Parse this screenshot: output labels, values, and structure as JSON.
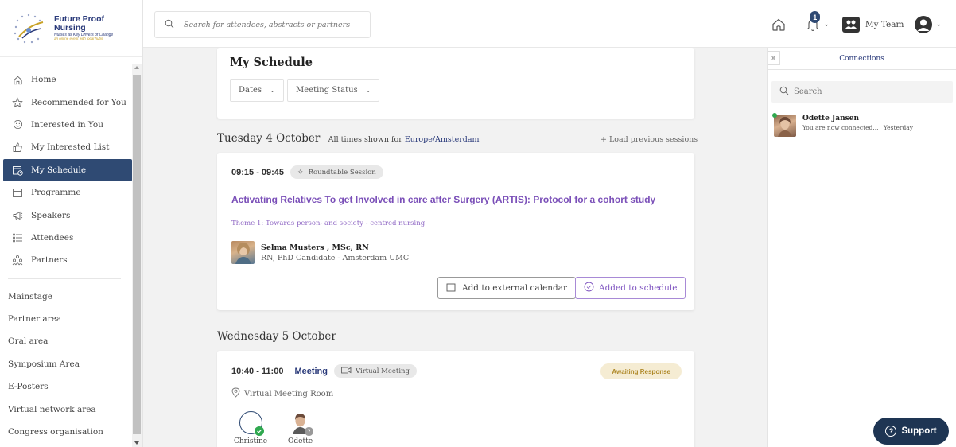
{
  "brand": {
    "title": "Future Proof Nursing",
    "subtitle": "Nurses as Key Drivers of Change",
    "tagline": "an online event with local hubs"
  },
  "sidebar": {
    "items": [
      {
        "label": "Home",
        "icon": "home-icon"
      },
      {
        "label": "Recommended for You",
        "icon": "star-icon"
      },
      {
        "label": "Interested in You",
        "icon": "smiley-icon"
      },
      {
        "label": "My Interested List",
        "icon": "thumbs-up-icon"
      },
      {
        "label": "My Schedule",
        "icon": "calendar-clock-icon",
        "active": true
      },
      {
        "label": "Programme",
        "icon": "calendar-icon"
      },
      {
        "label": "Speakers",
        "icon": "megaphone-icon"
      },
      {
        "label": "Attendees",
        "icon": "list-icon"
      },
      {
        "label": "Partners",
        "icon": "partners-icon"
      }
    ],
    "sections": [
      "Mainstage",
      "Partner area",
      "Oral area",
      "Symposium Area",
      "E-Posters",
      "Virtual network area",
      "Congress organisation"
    ]
  },
  "topbar": {
    "search_placeholder": "Search for attendees, abstracts or partners",
    "notification_count": "1",
    "team_label": "My Team"
  },
  "schedule": {
    "title": "My Schedule",
    "filters": [
      "Dates",
      "Meeting Status"
    ]
  },
  "day1": {
    "heading": "Tuesday 4 October",
    "tz_prefix": "All times shown for",
    "tz_link": "Europe/Amsterdam",
    "load_prev": "+ Load previous sessions"
  },
  "session": {
    "time": "09:15 - 09:45",
    "type": "Roundtable Session",
    "title": "Activating Relatives To get Involved in care after Surgery (ARTIS): Protocol for a cohort study",
    "theme": "Theme 1: Towards person- and society - centred nursing",
    "speaker_name": "Selma Musters , MSc, RN",
    "speaker_role": "RN, PhD Candidate - Amsterdam UMC",
    "btn_calendar": "Add to external calendar",
    "btn_added": "Added to schedule"
  },
  "day2": {
    "heading": "Wednesday 5 October"
  },
  "meeting": {
    "time": "10:40 - 11:00",
    "label": "Meeting",
    "type": "Virtual Meeting",
    "status": "Awaiting Response",
    "room": "Virtual Meeting Room",
    "attendees": [
      "Christine",
      "Odette"
    ]
  },
  "connections": {
    "title": "Connections",
    "search_placeholder": "Search",
    "items": [
      {
        "name": "Odette Jansen",
        "message": "You are now connected...",
        "time": "Yesterday"
      }
    ]
  },
  "support": {
    "label": "Support"
  },
  "colors": {
    "primary": "#2f4a73",
    "accent": "#7a4fb8",
    "online": "#2fa84f",
    "support_bg": "#1e3553"
  }
}
